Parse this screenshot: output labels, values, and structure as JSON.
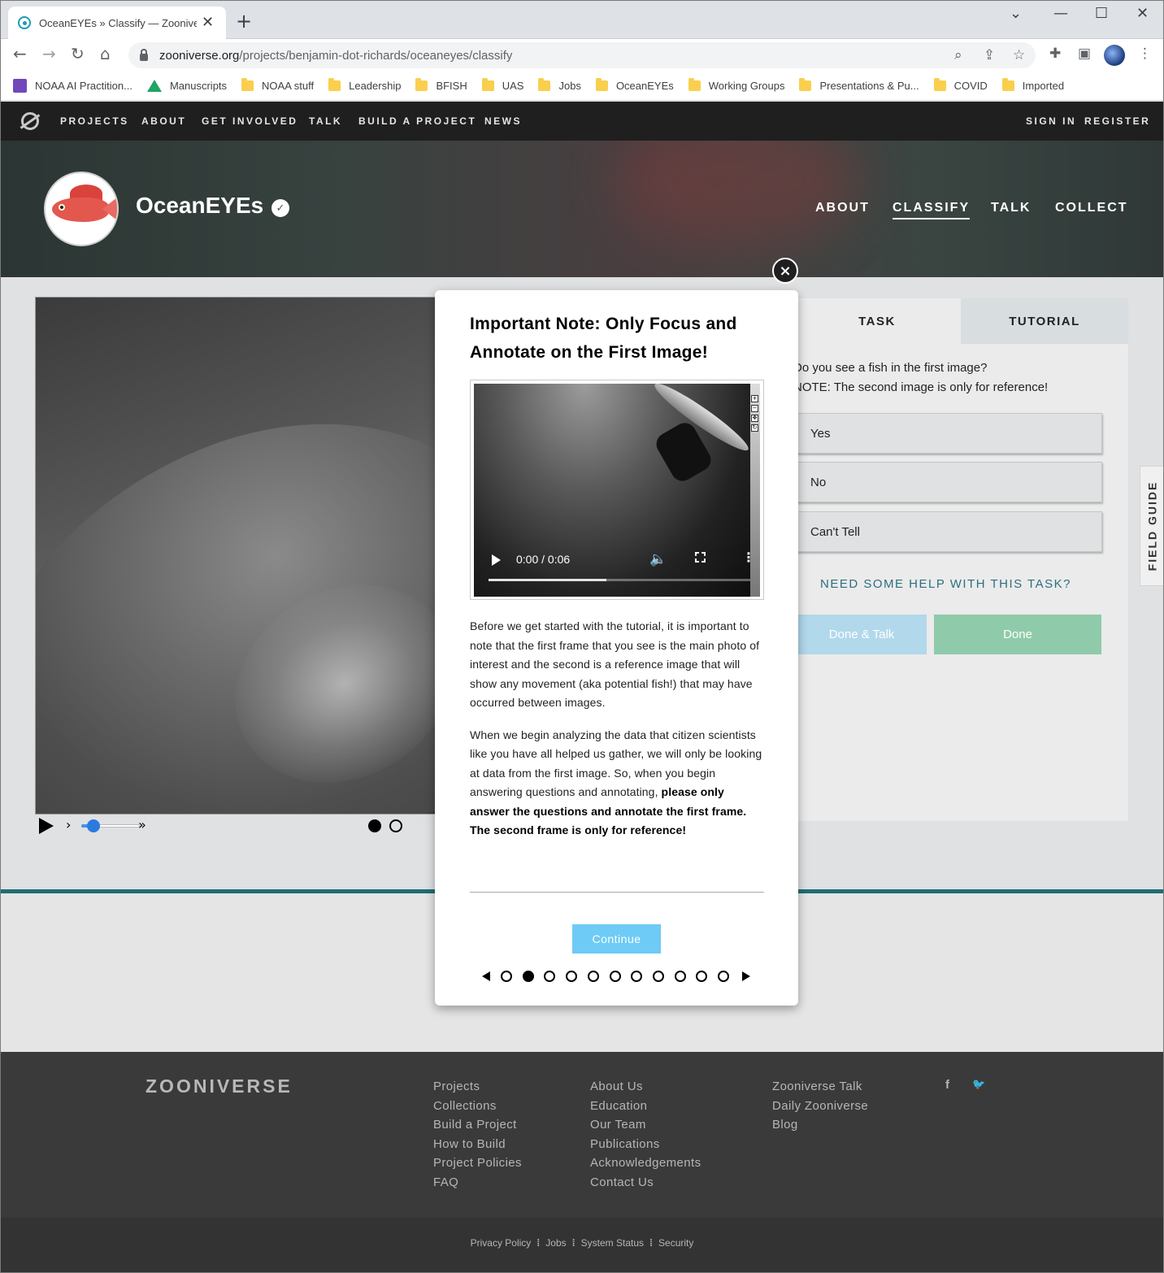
{
  "browser": {
    "tab_title": "OceanEYEs » Classify — Zooniverse",
    "tab_close": "✕",
    "new_tab": "+",
    "url_host": "zooniverse.org",
    "url_path": "/projects/benjamin-dot-richards/oceaneyes/classify",
    "bookmarks": [
      {
        "label": "NOAA AI Practition...",
        "icon": "form-icon"
      },
      {
        "label": "Manuscripts",
        "icon": "drive-icon"
      },
      {
        "label": "NOAA stuff",
        "icon": "folder-icon"
      },
      {
        "label": "Leadership",
        "icon": "folder-icon"
      },
      {
        "label": "BFISH",
        "icon": "folder-icon"
      },
      {
        "label": "UAS",
        "icon": "folder-icon"
      },
      {
        "label": "Jobs",
        "icon": "folder-icon"
      },
      {
        "label": "OceanEYEs",
        "icon": "folder-icon"
      },
      {
        "label": "Working Groups",
        "icon": "folder-icon"
      },
      {
        "label": "Presentations & Pu...",
        "icon": "folder-icon"
      },
      {
        "label": "COVID",
        "icon": "folder-icon"
      },
      {
        "label": "Imported",
        "icon": "folder-icon"
      }
    ]
  },
  "zooniverse_nav": {
    "items": [
      "PROJECTS",
      "ABOUT",
      "GET INVOLVED",
      "TALK",
      "BUILD A PROJECT",
      "NEWS"
    ],
    "sign_in": "SIGN IN",
    "register": "REGISTER"
  },
  "project": {
    "title": "OceanEYEs",
    "verified_mark": "✓",
    "nav": [
      "ABOUT",
      "CLASSIFY",
      "TALK",
      "COLLECT"
    ],
    "active_nav": "CLASSIFY"
  },
  "task_panel": {
    "tabs": [
      "TASK",
      "TUTORIAL"
    ],
    "question_line1": "Do you see a fish in the first image?",
    "question_line2": "NOTE: The second image is only for reference!",
    "answers": [
      "Yes",
      "No",
      "Can't Tell"
    ],
    "help_link": "NEED SOME HELP WITH THIS TASK?",
    "done_talk": "Done & Talk",
    "done": "Done",
    "field_guide": "FIELD GUIDE"
  },
  "subject_viewer": {
    "chevron": "›",
    "double_chevron": "»",
    "frames": 2,
    "active_frame": 0
  },
  "modal": {
    "close": "×",
    "title": "Important Note: Only Focus and Annotate on the First Image!",
    "video_time": "0:00 / 0:06",
    "video_progress": 0.45,
    "volume_glyph": "🔈",
    "menu_glyph": "⋮",
    "paragraph1": "Before we get started with the tutorial, it is important to note that the first frame that you see is the main photo of interest and the second is a reference image that will show any movement (aka potential fish!) that may have occurred between images.",
    "paragraph2_plain": "When we begin analyzing the data that citizen scientists like you have all helped us gather, we will only be looking at data from the first image. So, when you begin answering questions and annotating, ",
    "paragraph2_bold": "please only answer the questions and annotate the first frame. The second frame is only for reference!",
    "continue": "Continue",
    "pages": 11,
    "active_page": 1
  },
  "footer": {
    "wordmark": "ZOONIVERSE",
    "col1": [
      "Projects",
      "Collections",
      "Build a Project",
      "How to Build",
      "Project Policies",
      "FAQ"
    ],
    "col2": [
      "About Us",
      "Education",
      "Our Team",
      "Publications",
      "Acknowledgements",
      "Contact Us"
    ],
    "col3": [
      "Zooniverse Talk",
      "Daily Zooniverse",
      "Blog"
    ],
    "social": {
      "facebook": "f",
      "twitter": "🐦"
    },
    "legal": [
      "Privacy Policy",
      "Jobs",
      "System Status",
      "Security"
    ]
  },
  "colors": {
    "teal_accent": "#1f6e74",
    "continue_button": "#6ecbf5",
    "done_button": "#8fcbaa",
    "done_talk_button": "#b2d8ec",
    "help_link": "#2c6f7e"
  }
}
